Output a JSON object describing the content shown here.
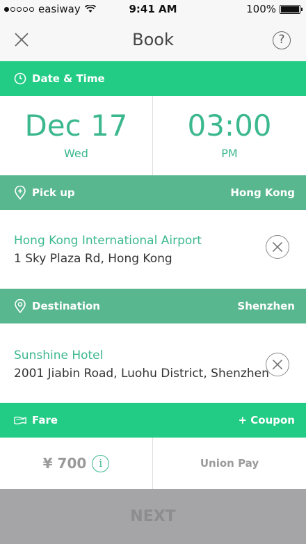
{
  "status_bar": {
    "carrier": "easiway",
    "time": "9:41 AM",
    "battery": "100%"
  },
  "nav": {
    "title": "Book",
    "close_icon": "close-icon",
    "help_icon": "help-icon",
    "help_glyph": "?"
  },
  "date_time": {
    "label": "Date & Time",
    "date": "Dec 17",
    "weekday": "Wed",
    "time": "03:00",
    "meridiem": "PM"
  },
  "pickup": {
    "label": "Pick up",
    "region": "Hong Kong",
    "name": "Hong Kong International Airport",
    "address": "1 Sky Plaza Rd, Hong Kong"
  },
  "destination": {
    "label": "Destination",
    "region": "Shenzhen",
    "name": "Sunshine Hotel",
    "address": "2001 Jiabin Road, Luohu District, Shenzhen"
  },
  "fare": {
    "label": "Fare",
    "coupon_label": "+ Coupon",
    "amount": "¥ 700",
    "info_glyph": "i",
    "payment_method": "Union Pay"
  },
  "next_label": "NEXT",
  "colors": {
    "accent": "#22cc85",
    "muted": "#59b790",
    "text_accent": "#3cb88e",
    "disabled": "#a5a5a7"
  }
}
